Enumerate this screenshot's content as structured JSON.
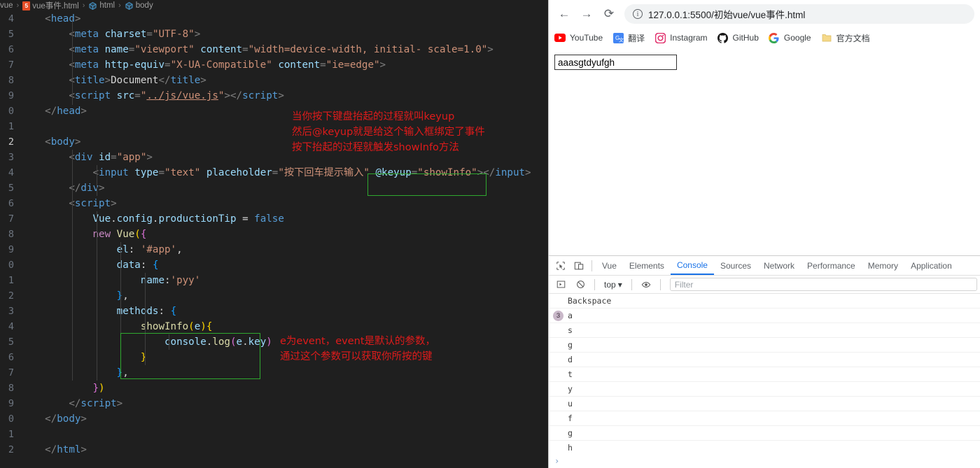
{
  "editor": {
    "breadcrumb": {
      "items": [
        {
          "label": "vue",
          "icon": "none"
        },
        {
          "label": "vue事件.html",
          "icon": "html5-icon"
        },
        {
          "label": "html",
          "icon": "cube-icon"
        },
        {
          "label": "body",
          "icon": "cube-icon"
        }
      ],
      "separator": "›"
    },
    "lines": [
      {
        "n": "4",
        "indent": 1
      },
      {
        "n": "5",
        "indent": 2
      },
      {
        "n": "6",
        "indent": 2
      },
      {
        "n": "7",
        "indent": 2
      },
      {
        "n": "8",
        "indent": 2
      },
      {
        "n": "9",
        "indent": 2
      },
      {
        "n": "0",
        "indent": 1
      },
      {
        "n": "1",
        "indent": 0
      },
      {
        "n": "2",
        "indent": 1
      },
      {
        "n": "3",
        "indent": 2
      },
      {
        "n": "4",
        "indent": 3
      },
      {
        "n": "5",
        "indent": 2
      },
      {
        "n": "6",
        "indent": 2
      },
      {
        "n": "7",
        "indent": 3
      },
      {
        "n": "8",
        "indent": 3
      },
      {
        "n": "9",
        "indent": 4
      },
      {
        "n": "0",
        "indent": 4
      },
      {
        "n": "1",
        "indent": 5
      },
      {
        "n": "2",
        "indent": 4
      },
      {
        "n": "3",
        "indent": 4
      },
      {
        "n": "4",
        "indent": 5
      },
      {
        "n": "5",
        "indent": 6
      },
      {
        "n": "6",
        "indent": 5
      },
      {
        "n": "7",
        "indent": 4
      },
      {
        "n": "8",
        "indent": 3
      },
      {
        "n": "9",
        "indent": 2
      },
      {
        "n": "0",
        "indent": 1
      },
      {
        "n": "1",
        "indent": 0
      },
      {
        "n": "2",
        "indent": 1
      }
    ],
    "active_line": "2",
    "code": {
      "l4": "<head>",
      "l5": "<meta charset=\"UTF-8\">",
      "l6": "<meta name=\"viewport\" content=\"width=device-width, initial- scale=1.0\">",
      "l7": "<meta http-equiv=\"X-UA-Compatible\" content=\"ie=edge\">",
      "l8": "<title>Document</title>",
      "l9": "<script src=\"../js/vue.js\"></script>",
      "l10": "</head>",
      "l12": "<body>",
      "l13": "<div id=\"app\">",
      "l14": "<input type=\"text\" placeholder=\"按下回车提示输入\" @keyup=\"showInfo\"></input>",
      "l15": "</div>",
      "l16": "<script>",
      "l17": "Vue.config.productionTip = false",
      "l18": "new Vue({",
      "l19": "el: '#app',",
      "l20": "data: {",
      "l21": "name:'pyy'",
      "l22": "},",
      "l23": "methods: {",
      "l24": "showInfo(e){",
      "l25": "console.log(e.key)",
      "l26": "}",
      "l27": "},",
      "l28": "})",
      "l29": "</script>",
      "l30": "</body>",
      "l32": "</html>"
    },
    "annotations": [
      {
        "name": "keyup-note",
        "color": "#e01b1b",
        "lines": [
          "当你按下键盘抬起的过程就叫keyup",
          "然后@keyup就是给这个输入框绑定了事件",
          "按下抬起的过程就触发showInfo方法"
        ]
      },
      {
        "name": "event-param-note",
        "color": "#e01b1b",
        "lines": [
          "e为event，event是默认的参数，",
          "通过这个参数可以获取你所按的键"
        ]
      }
    ],
    "highlight_boxes": [
      {
        "name": "keyup-attribute-box",
        "color": "#2fa82f"
      },
      {
        "name": "showinfo-method-box",
        "color": "#2fa82f"
      }
    ]
  },
  "browser": {
    "nav": {
      "back_icon": "←",
      "forward_icon": "→",
      "reload_icon": "⟳",
      "url": "127.0.0.1:5500/初始vue/vue事件.html",
      "site_info_icon": "ⓘ"
    },
    "bookmarks": [
      {
        "label": "YouTube",
        "icon": "youtube-icon"
      },
      {
        "label": "翻译",
        "icon": "google-translate-icon"
      },
      {
        "label": "Instagram",
        "icon": "instagram-icon"
      },
      {
        "label": "GitHub",
        "icon": "github-icon"
      },
      {
        "label": "Google",
        "icon": "google-icon"
      },
      {
        "label": "官方文档",
        "icon": "folder-icon"
      }
    ],
    "page": {
      "input_value": "aaasgtdyufgh",
      "input_placeholder": "按下回车提示输入"
    }
  },
  "devtools": {
    "tabs": [
      {
        "label": "Vue",
        "active": false
      },
      {
        "label": "Elements",
        "active": false
      },
      {
        "label": "Console",
        "active": true
      },
      {
        "label": "Sources",
        "active": false
      },
      {
        "label": "Network",
        "active": false
      },
      {
        "label": "Performance",
        "active": false
      },
      {
        "label": "Memory",
        "active": false
      },
      {
        "label": "Application",
        "active": false
      }
    ],
    "toolbar": {
      "context": "top",
      "context_caret": "▾",
      "filter_placeholder": "Filter"
    },
    "console_entries": [
      {
        "message": "Backspace",
        "count": null
      },
      {
        "message": "a",
        "count": "3"
      },
      {
        "message": "s",
        "count": null
      },
      {
        "message": "g",
        "count": null
      },
      {
        "message": "d",
        "count": null
      },
      {
        "message": "t",
        "count": null
      },
      {
        "message": "y",
        "count": null
      },
      {
        "message": "u",
        "count": null
      },
      {
        "message": "f",
        "count": null
      },
      {
        "message": "g",
        "count": null
      },
      {
        "message": "h",
        "count": null
      }
    ],
    "prompt_symbol": "›"
  }
}
